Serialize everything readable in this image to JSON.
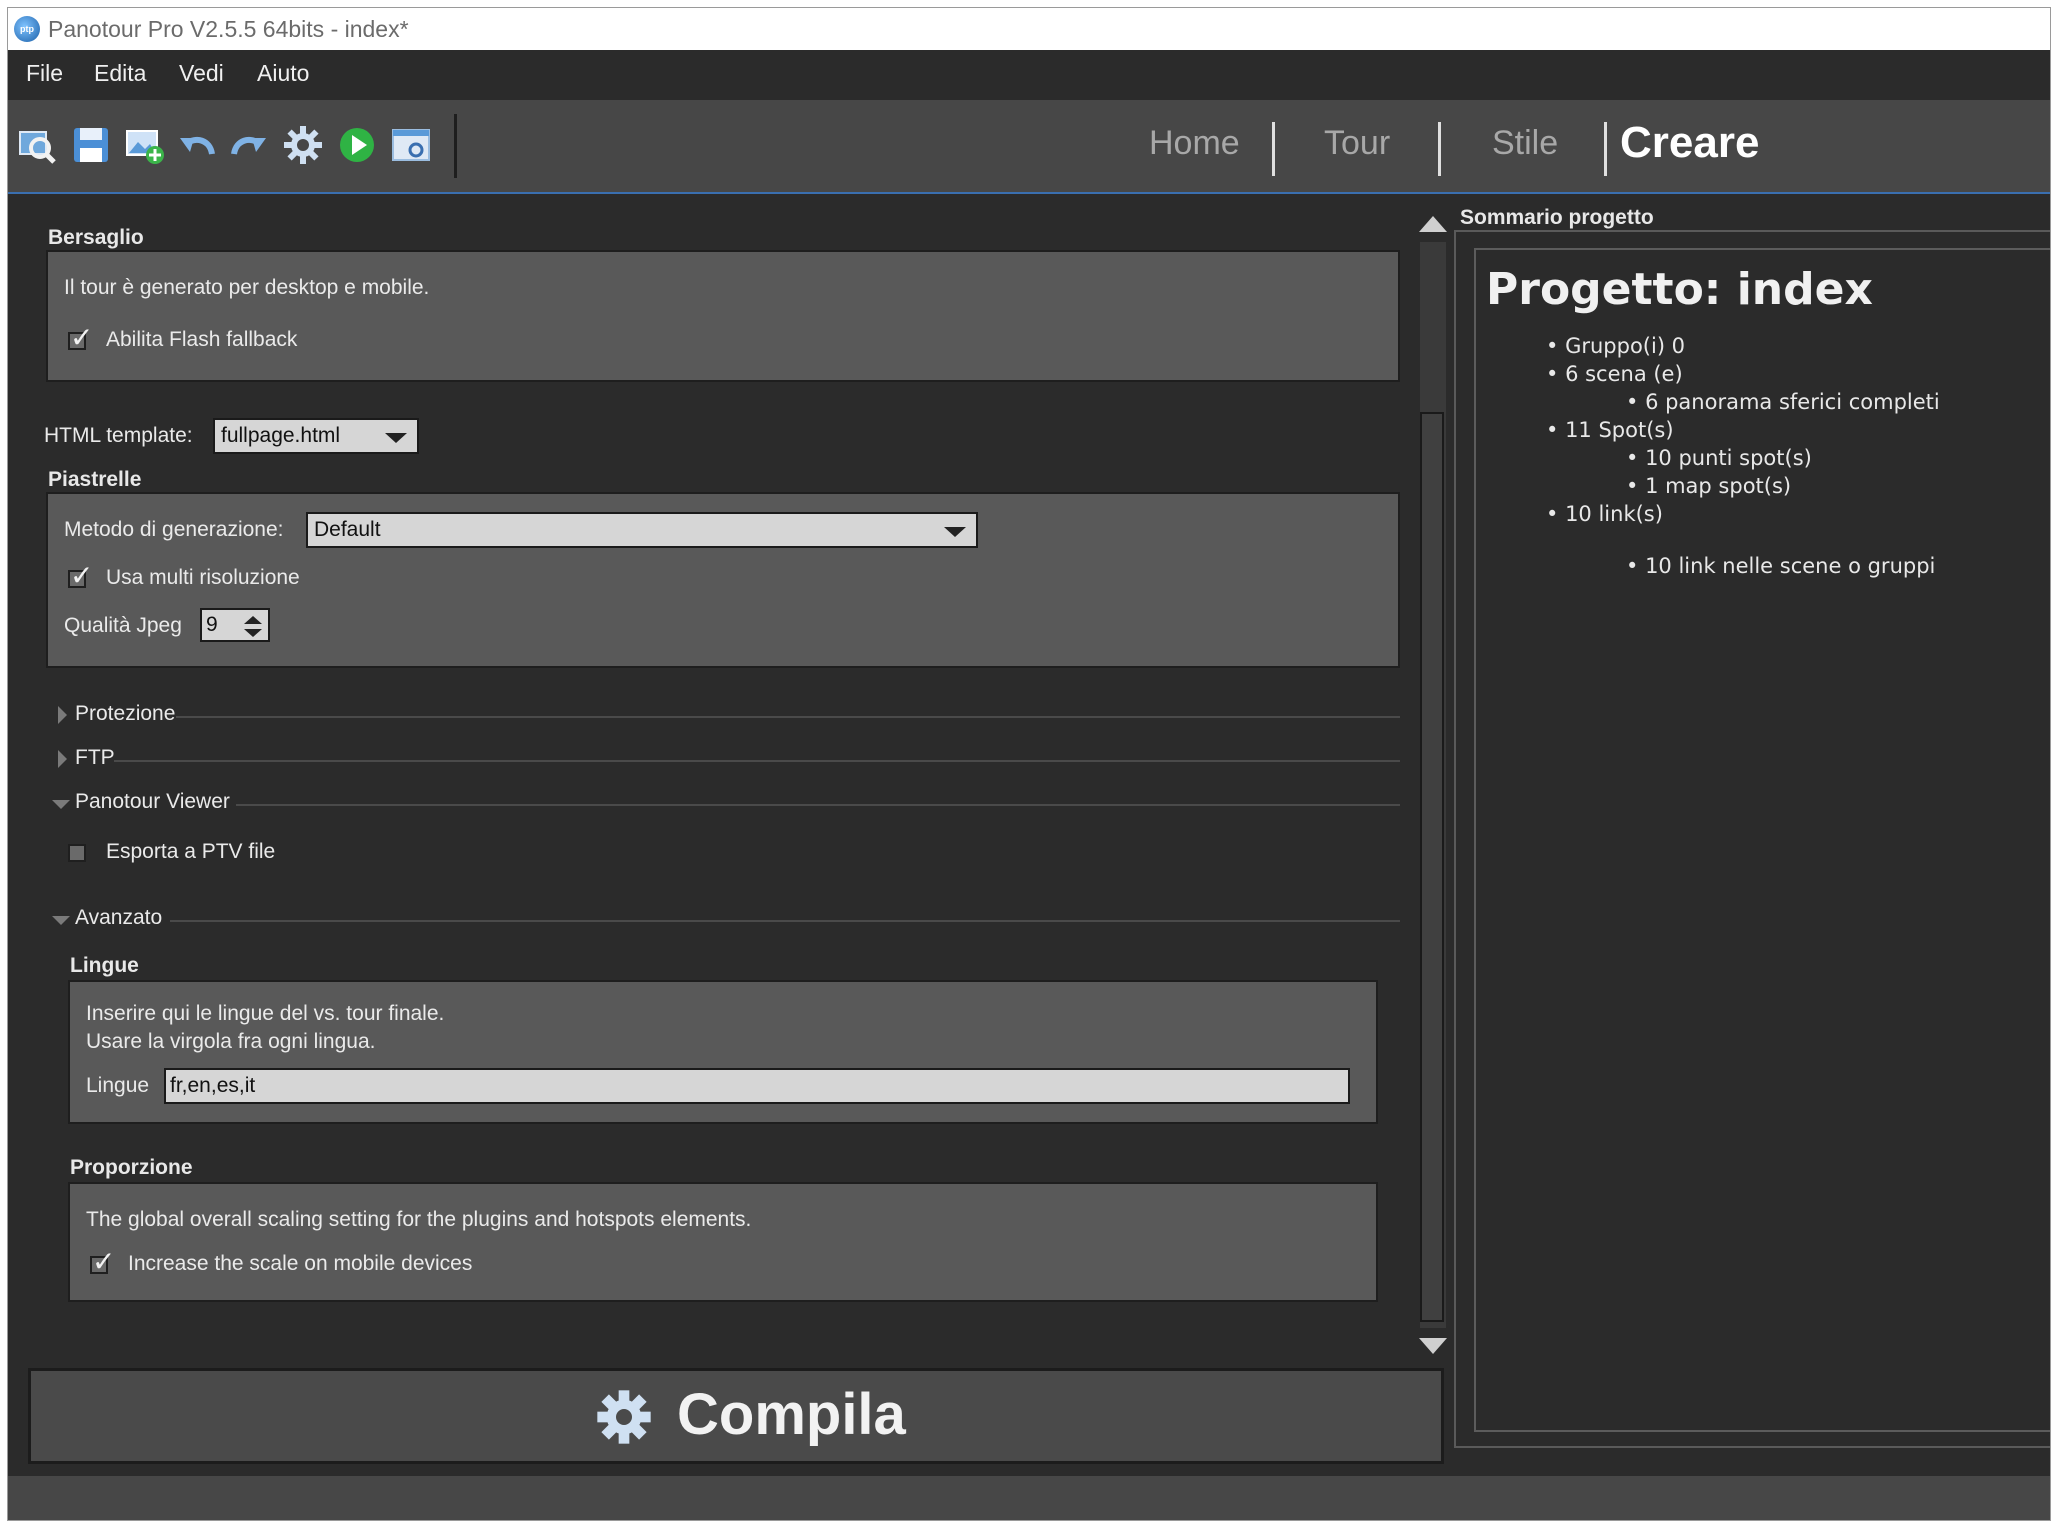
{
  "window": {
    "title": "Panotour Pro V2.5.5 64bits - index*",
    "app_icon": "ptp"
  },
  "menu": {
    "items": [
      "File",
      "Edita",
      "Vedi",
      "Aiuto"
    ]
  },
  "toolbar": {
    "icons": [
      "find-icon",
      "save-icon",
      "add-panorama-icon",
      "undo-icon",
      "redo-icon",
      "settings-gear-icon",
      "play-icon",
      "preview-window-icon"
    ]
  },
  "nav_tabs": [
    "Home",
    "Tour",
    "Stile",
    "Creare"
  ],
  "target": {
    "title": "Bersaglio",
    "description": "Il tour è generato per desktop e mobile.",
    "flash_fallback_label": "Abilita Flash fallback",
    "flash_fallback_checked": true
  },
  "html_template": {
    "label": "HTML template:",
    "value": "fullpage.html"
  },
  "tiles": {
    "title": "Piastrelle",
    "method_label": "Metodo di generazione:",
    "method_value": "Default",
    "multires_label": "Usa multi risoluzione",
    "multires_checked": true,
    "jpeg_label": "Qualità Jpeg",
    "jpeg_value": "9"
  },
  "sections": {
    "protection": "Protezione",
    "ftp": "FTP",
    "viewer": "Panotour Viewer",
    "advanced": "Avanzato"
  },
  "viewer": {
    "export_label": "Esporta a PTV file",
    "export_checked": false
  },
  "languages": {
    "title": "Lingue",
    "line1": "Inserire qui le lingue del vs. tour finale.",
    "line2": "Usare la virgola fra ogni lingua.",
    "field_label": "Lingue",
    "field_value": "fr,en,es,it"
  },
  "proportion": {
    "title": "Proporzione",
    "description": "The global overall scaling setting for the plugins and hotspots elements.",
    "scale_label": "Increase the scale on mobile devices",
    "scale_checked": true
  },
  "compile": {
    "label": "Compila"
  },
  "summary": {
    "panel_title": "Sommario progetto",
    "heading": "Progetto: index",
    "groups": "Gruppo(i) 0",
    "scenes": "6 scena (e)",
    "panoramas": "6 panorama sferici completi",
    "spots": "11 Spot(s)",
    "point_spots": "10 punti spot(s)",
    "map_spots": "1 map spot(s)",
    "links": "10 link(s)",
    "links_detail": "10 link nelle scene o gruppi"
  }
}
